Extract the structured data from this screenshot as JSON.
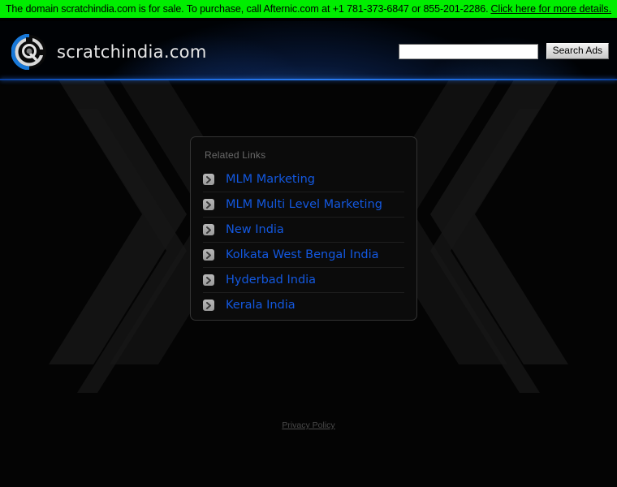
{
  "banner": {
    "message": "The domain scratchindia.com is for sale. To purchase, call Afternic.com at +1 781-373-6847 or 855-201-2286.",
    "link_label": "Click here for more details.",
    "background_color": "#00ee00",
    "text_color": "#000000"
  },
  "header": {
    "brand_name": "scratchindia.com",
    "logo_icon": "circular-search-logo-icon",
    "accent_color": "#2a7bf0"
  },
  "search": {
    "value": "",
    "placeholder": "",
    "button_label": "Search Ads"
  },
  "related_links": {
    "title": "Related Links",
    "bullet_icon": "chevron-right-icon",
    "link_color": "#1358e0",
    "items": [
      {
        "label": "MLM Marketing"
      },
      {
        "label": "MLM Multi Level Marketing"
      },
      {
        "label": "New India"
      },
      {
        "label": "Kolkata West Bengal India"
      },
      {
        "label": "Hyderbad India"
      },
      {
        "label": "Kerala India"
      }
    ]
  },
  "footer": {
    "privacy_label": "Privacy Policy"
  }
}
